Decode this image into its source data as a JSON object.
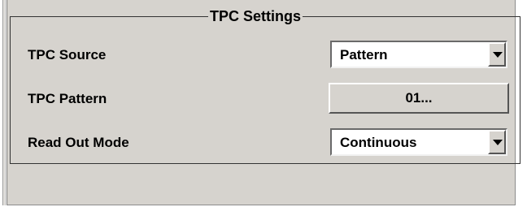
{
  "groupbox": {
    "title": "TPC Settings"
  },
  "rows": [
    {
      "label": "TPC Source",
      "control": "combo",
      "value": "Pattern"
    },
    {
      "label": "TPC Pattern",
      "control": "button",
      "value": "01..."
    },
    {
      "label": "Read Out Mode",
      "control": "combo",
      "value": "Continuous"
    }
  ],
  "icons": {
    "dropdown": "chevron-down-icon"
  }
}
